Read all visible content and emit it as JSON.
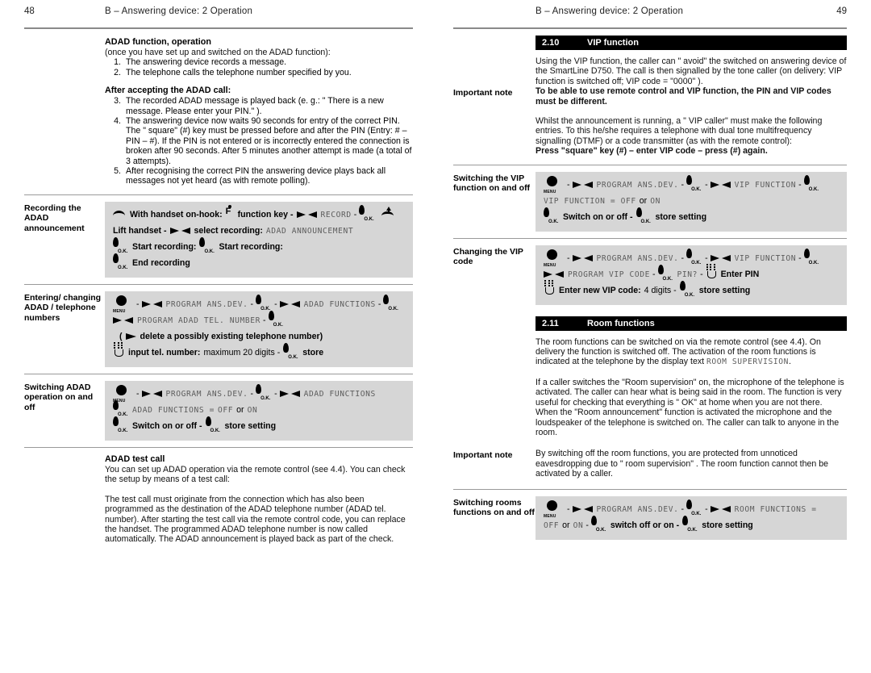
{
  "left_page": {
    "folio": "48",
    "running_head": "B – Answering device:  2   Operation",
    "adad_operation": {
      "heading": "ADAD function, operation",
      "intro": "(once you have set up and switched on the ADAD function):",
      "steps": [
        {
          "num": "1.",
          "text": "The answering device records a message."
        },
        {
          "num": "2.",
          "text": "The telephone calls the telephone number specified by you."
        }
      ],
      "after_heading": "After accepting the ADAD call:",
      "after_steps": [
        {
          "num": "3.",
          "text": "The recorded ADAD message is played back (e. g.: \" There is a new message. Please enter your PIN.\" )."
        },
        {
          "num": "4.",
          "text": "The answering device now waits 90 seconds for entry of the correct PIN. The \" square\" (#) key must be pressed before and after the PIN (Entry: # – PIN – #). If the PIN is not entered or is incorrectly entered the connection is broken after 90 seconds. After 5 minutes another attempt is made (a total of 3 attempts)."
        },
        {
          "num": "5.",
          "text": "After recognising the correct PIN the answering device plays back all messages not yet heard (as with remote polling)."
        }
      ]
    },
    "recording": {
      "label": "Recording the ADAD announcement",
      "line1_a": "With handset on-hook:",
      "line1_b": "function key -",
      "line1_lcd": "RECORD",
      "line1_dash": "-",
      "line2_a": "Lift handset -",
      "line2_b": "select recording:",
      "line2_lcd": "ADAD ANNOUNCEMENT",
      "line3_a": "Start recording:",
      "line3_b": "Start recording:",
      "line4_a": "End recording"
    },
    "entering": {
      "label": "Entering/ changing ADAD / telephone numbers",
      "lcd1": "PROGRAM ANS.DEV.",
      "lcd2": "ADAD FUNCTIONS",
      "lcd3": "PROGRAM ADAD TEL. NUMBER",
      "paren": "delete a possibly existing telephone number)",
      "paren_open": "(",
      "input_label": "input tel. number:",
      "input_value": "maximum 20 digits -",
      "store": "store"
    },
    "switching_adad": {
      "label": "Switching ADAD operation on and off",
      "lcd1": "PROGRAM ANS.DEV.",
      "lcd2": "ADAD FUNCTIONS",
      "lcd3": "ADAD FUNCTIONS =",
      "off": "OFF",
      "or": "or",
      "on": "ON",
      "action1": "Switch on or off -",
      "action2": "store setting"
    },
    "test_call": {
      "heading": "ADAD test call",
      "para1": "You can set up ADAD operation via the remote control (see 4.4). You can check the setup by means of a test call:",
      "para2": "The test call must originate from the connection which has also been programmed as the destination of the ADAD telephone number (ADAD tel. number). After starting the test call via the remote control code, you can replace the handset. The programmed ADAD telephone number is now called automatically. The ADAD announcement is played back as part of the check."
    }
  },
  "right_page": {
    "folio": "49",
    "running_head": "B – Answering device:  2   Operation",
    "vip_section": {
      "number": "2.10",
      "title": "VIP function",
      "para1": "Using the VIP function, the caller can \" avoid\" the switched on answering device of the SmartLine D750. The call is then signalled by the tone caller (on delivery: VIP function is switched off; VIP code = \"0000\" ).",
      "note_label": "Important note",
      "note_bold": "To be able to use remote control and VIP function, the PIN and VIP codes must be different.",
      "para2": "Whilst the announcement is running, a \" VIP caller\"  must make the following entries. To this he/she requires a telephone with dual tone multifrequency signalling (DTMF) or a code transmitter (as with the remote control):",
      "para2_bold": "Press \"square\" key (#) – enter VIP code – press (#) again."
    },
    "switch_vip": {
      "label": "Switching the VIP function on and off",
      "lcd1": "PROGRAM ANS.DEV.",
      "lcd2": "VIP FUNCTION",
      "lcd3": "VIP FUNCTION = OFF",
      "or": "or",
      "on": "ON",
      "action1": "Switch on or off -",
      "action2": "store setting"
    },
    "change_vip_code": {
      "label": "Changing the VIP code",
      "lcd1": "PROGRAM ANS.DEV.",
      "lcd2": "VIP FUNCTION",
      "lcd3": "PROGRAM VIP CODE",
      "lcd4": "PIN?",
      "enter_pin": "Enter PIN",
      "enter_new": "Enter new  VIP code:",
      "digits": "4 digits -",
      "store": "store setting"
    },
    "room_section": {
      "number": "2.11",
      "title": "Room functions",
      "para1_a": "The room functions can be switched on via the remote control (see 4.4). On delivery the function is switched off. The activation of the room functions is indicated at the telephone by the display text ",
      "para1_lcd": "ROOM SUPERVISION",
      "para1_b": ".",
      "para2": "If a caller switches the \"Room supervision\" on, the microphone of the telephone is activated. The caller can hear what is being said in the room. The function is very useful for checking that everything is \" OK\"  at home when you are not there.",
      "para3": "When the \"Room announcement\" function is activated the microphone and the loudspeaker of the telephone is switched on. The caller can talk to anyone in the room.",
      "note_label": "Important note",
      "note_text": "By switching off the room functions, you are protected from unnoticed eavesdropping due to \" room supervision\" . The room function cannot then be activated by a caller."
    },
    "switch_room": {
      "label": "Switching rooms functions on and off",
      "lcd1": "PROGRAM ANS.DEV.",
      "lcd2": "ROOM FUNCTIONS =",
      "off": "OFF",
      "or": "or",
      "on": "ON",
      "action1": "switch off or on -",
      "action2": "store setting"
    }
  },
  "icons": {
    "menu": "MENU",
    "ok": "O.K.",
    "fkey": "F"
  }
}
